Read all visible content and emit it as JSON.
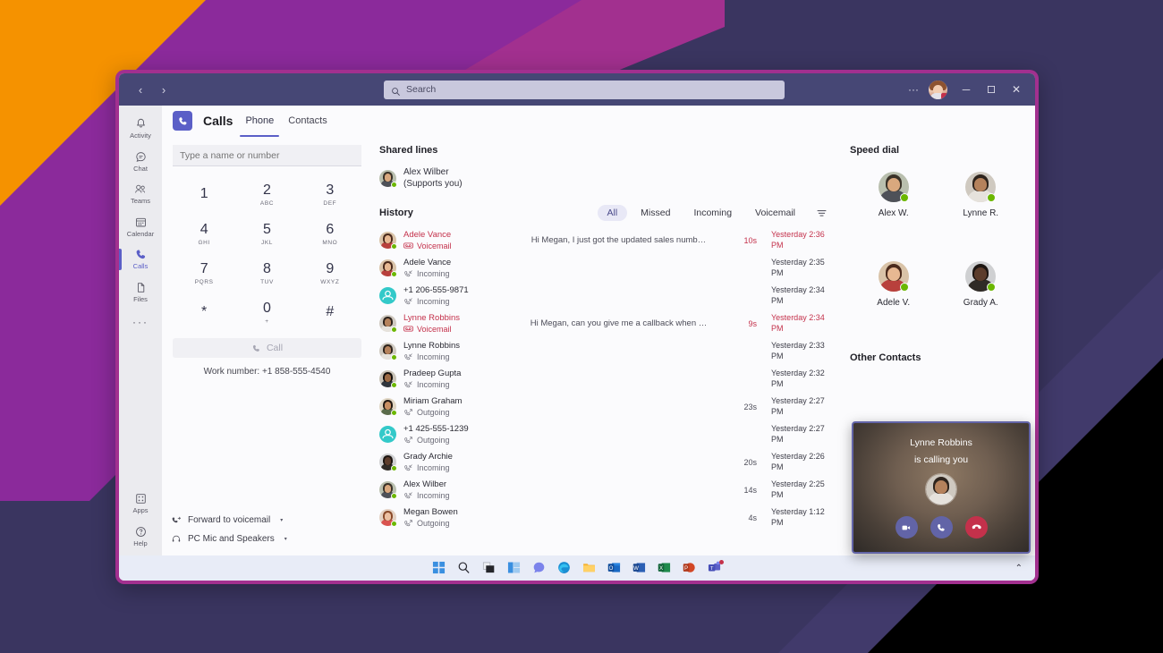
{
  "window": {
    "nav_back": "‹",
    "nav_forward": "›",
    "search_placeholder": "Search",
    "more_label": "···",
    "minimize_label": "─",
    "maximize_label": "❐",
    "close_label": "✕"
  },
  "rail": {
    "items": [
      {
        "label": "Activity",
        "icon": "bell-icon"
      },
      {
        "label": "Chat",
        "icon": "chat-icon"
      },
      {
        "label": "Teams",
        "icon": "teams-icon"
      },
      {
        "label": "Calendar",
        "icon": "calendar-icon"
      },
      {
        "label": "Calls",
        "icon": "phone-icon"
      },
      {
        "label": "Files",
        "icon": "file-icon"
      }
    ],
    "more": "···",
    "bottom": [
      {
        "label": "Apps",
        "icon": "apps-icon"
      },
      {
        "label": "Help",
        "icon": "help-icon"
      }
    ]
  },
  "header": {
    "app_icon": "phone-icon",
    "title": "Calls",
    "tabs": [
      {
        "label": "Phone",
        "active": true
      },
      {
        "label": "Contacts",
        "active": false
      }
    ]
  },
  "dialpad": {
    "input_placeholder": "Type a name or number",
    "input_value": "",
    "keys": [
      {
        "digit": "1",
        "sub": ""
      },
      {
        "digit": "2",
        "sub": "ABC"
      },
      {
        "digit": "3",
        "sub": "DEF"
      },
      {
        "digit": "4",
        "sub": "GHI"
      },
      {
        "digit": "5",
        "sub": "JKL"
      },
      {
        "digit": "6",
        "sub": "MNO"
      },
      {
        "digit": "7",
        "sub": "PQRS"
      },
      {
        "digit": "8",
        "sub": "TUV"
      },
      {
        "digit": "9",
        "sub": "WXYZ"
      },
      {
        "digit": "*",
        "sub": ""
      },
      {
        "digit": "0",
        "sub": "+"
      },
      {
        "digit": "#",
        "sub": ""
      }
    ],
    "call_button": "Call",
    "work_number": "Work number: +1 858-555-4540",
    "footer": [
      {
        "label": "Forward to voicemail",
        "icon": "call-forward-icon",
        "caret": "▾"
      },
      {
        "label": "PC Mic and Speakers",
        "icon": "headset-icon",
        "caret": "▾"
      }
    ]
  },
  "shared_lines": {
    "title": "Shared lines",
    "person": {
      "name": "Alex Wilber",
      "note": "(Supports you)",
      "presence": "available"
    }
  },
  "history": {
    "title": "History",
    "filters": [
      {
        "label": "All",
        "active": true
      },
      {
        "label": "Missed",
        "active": false
      },
      {
        "label": "Incoming",
        "active": false
      },
      {
        "label": "Voicemail",
        "active": false
      }
    ],
    "filter_icon": "filter-icon",
    "rows": [
      {
        "name": "Adele Vance",
        "type": "Voicemail",
        "voicemail": true,
        "preview": "Hi Megan, I just got the updated sales numb…",
        "duration": "10s",
        "time": "Yesterday 2:36 PM",
        "avatar": "adele"
      },
      {
        "name": "Adele Vance",
        "type": "Incoming",
        "voicemail": false,
        "preview": "",
        "duration": "",
        "time": "Yesterday 2:35 PM",
        "avatar": "adele"
      },
      {
        "name": "+1 206-555-9871",
        "type": "Incoming",
        "voicemail": false,
        "preview": "",
        "duration": "",
        "time": "Yesterday 2:34 PM",
        "avatar": "generic"
      },
      {
        "name": "Lynne Robbins",
        "type": "Voicemail",
        "voicemail": true,
        "preview": "Hi Megan, can you give me a callback when …",
        "duration": "9s",
        "time": "Yesterday 2:34 PM",
        "avatar": "lynne"
      },
      {
        "name": "Lynne Robbins",
        "type": "Incoming",
        "voicemail": false,
        "preview": "",
        "duration": "",
        "time": "Yesterday 2:33 PM",
        "avatar": "lynne"
      },
      {
        "name": "Pradeep Gupta",
        "type": "Incoming",
        "voicemail": false,
        "preview": "",
        "duration": "",
        "time": "Yesterday 2:32 PM",
        "avatar": "pradeep"
      },
      {
        "name": "Miriam Graham",
        "type": "Outgoing",
        "voicemail": false,
        "preview": "",
        "duration": "23s",
        "time": "Yesterday 2:27 PM",
        "avatar": "miriam"
      },
      {
        "name": "+1 425-555-1239",
        "type": "Outgoing",
        "voicemail": false,
        "preview": "",
        "duration": "",
        "time": "Yesterday 2:27 PM",
        "avatar": "generic"
      },
      {
        "name": "Grady Archie",
        "type": "Incoming",
        "voicemail": false,
        "preview": "",
        "duration": "20s",
        "time": "Yesterday 2:26 PM",
        "avatar": "grady"
      },
      {
        "name": "Alex Wilber",
        "type": "Incoming",
        "voicemail": false,
        "preview": "",
        "duration": "14s",
        "time": "Yesterday 2:25 PM",
        "avatar": "alex"
      },
      {
        "name": "Megan Bowen",
        "type": "Outgoing",
        "voicemail": false,
        "preview": "",
        "duration": "4s",
        "time": "Yesterday 1:12 PM",
        "avatar": "megan"
      }
    ]
  },
  "speed_dial": {
    "title": "Speed dial",
    "contacts": [
      {
        "name": "Alex W.",
        "avatar": "alex",
        "presence": "available"
      },
      {
        "name": "Lynne R.",
        "avatar": "lynne",
        "presence": "available"
      },
      {
        "name": "Adele V.",
        "avatar": "adele",
        "presence": "available"
      },
      {
        "name": "Grady A.",
        "avatar": "grady",
        "presence": "available"
      }
    ],
    "other_contacts_title": "Other Contacts"
  },
  "incoming_call": {
    "caller": "Lynne Robbins",
    "subtitle": "is calling you",
    "actions": [
      {
        "name": "accept-video",
        "icon": "video-icon",
        "color": "#6264a7"
      },
      {
        "name": "accept-audio",
        "icon": "phone-icon",
        "color": "#6264a7"
      },
      {
        "name": "decline",
        "icon": "decline-icon",
        "color": "#c4314b"
      }
    ]
  },
  "taskbar": {
    "items": [
      {
        "name": "start",
        "label": "Start"
      },
      {
        "name": "search",
        "label": "Search"
      },
      {
        "name": "task-view",
        "label": "Task View"
      },
      {
        "name": "widgets",
        "label": "Widgets"
      },
      {
        "name": "chat",
        "label": "Chat"
      },
      {
        "name": "edge",
        "label": "Microsoft Edge"
      },
      {
        "name": "file-explorer",
        "label": "File Explorer"
      },
      {
        "name": "outlook",
        "label": "Outlook"
      },
      {
        "name": "word",
        "label": "Word"
      },
      {
        "name": "excel",
        "label": "Excel"
      },
      {
        "name": "powerpoint",
        "label": "PowerPoint"
      },
      {
        "name": "teams",
        "label": "Microsoft Teams"
      }
    ],
    "caret": "⌃"
  },
  "colors": {
    "teams_purple": "#5b5fc7",
    "titlebar": "#464775",
    "accent_magenta": "#a2308f",
    "accent_orange": "#f59200",
    "alert_red": "#c4314b",
    "presence_green": "#6bb700"
  }
}
